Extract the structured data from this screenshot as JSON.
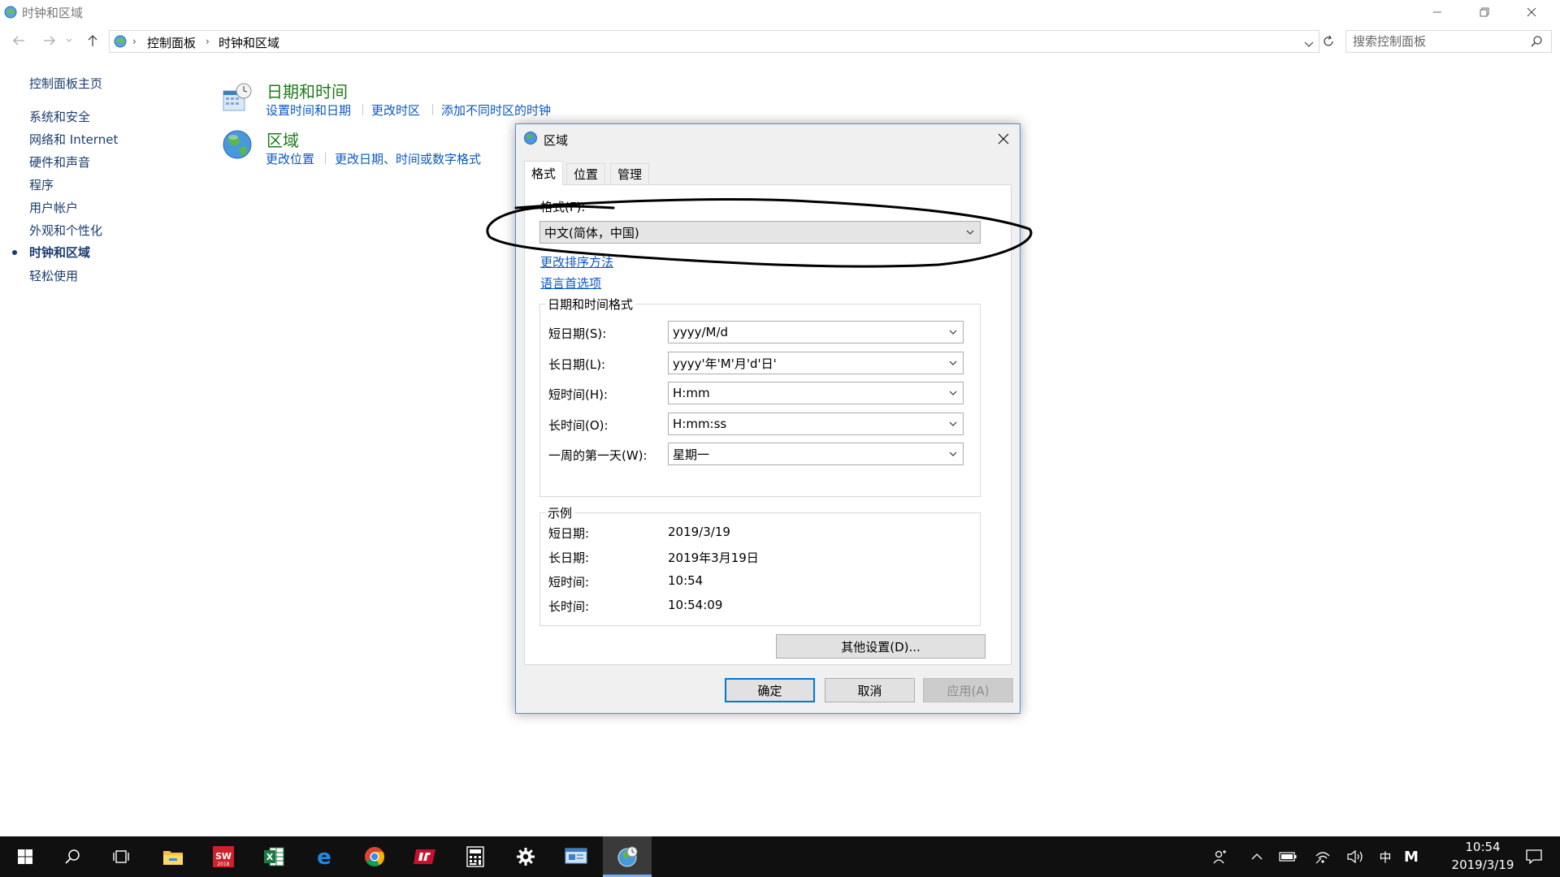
{
  "window": {
    "title": "时钟和区域"
  },
  "address": {
    "breadcrumb": [
      "控制面板",
      "时钟和区域"
    ],
    "search_placeholder": "搜索控制面板"
  },
  "sidebar": {
    "home": "控制面板主页",
    "items": [
      {
        "label": "系统和安全",
        "active": false
      },
      {
        "label": "网络和 Internet",
        "active": false
      },
      {
        "label": "硬件和声音",
        "active": false
      },
      {
        "label": "程序",
        "active": false
      },
      {
        "label": "用户帐户",
        "active": false
      },
      {
        "label": "外观和个性化",
        "active": false
      },
      {
        "label": "时钟和区域",
        "active": true
      },
      {
        "label": "轻松使用",
        "active": false
      }
    ]
  },
  "categories": {
    "datetime": {
      "title": "日期和时间",
      "links": [
        "设置时间和日期",
        "更改时区",
        "添加不同时区的时钟"
      ]
    },
    "region": {
      "title": "区域",
      "links": [
        "更改位置",
        "更改日期、时间或数字格式"
      ]
    }
  },
  "dialog": {
    "title": "区域",
    "tabs": [
      "格式",
      "位置",
      "管理"
    ],
    "active_tab": "格式",
    "format_label": "格式(F):",
    "format_value": "中文(简体，中国)",
    "links": [
      "更改排序方法",
      "语言首选项"
    ],
    "datetime_group": {
      "title": "日期和时间格式",
      "rows": [
        {
          "label": "短日期(S):",
          "value": "yyyy/M/d"
        },
        {
          "label": "长日期(L):",
          "value": "yyyy'年'M'月'd'日'"
        },
        {
          "label": "短时间(H):",
          "value": "H:mm"
        },
        {
          "label": "长时间(O):",
          "value": "H:mm:ss"
        },
        {
          "label": "一周的第一天(W):",
          "value": "星期一"
        }
      ]
    },
    "example_group": {
      "title": "示例",
      "rows": [
        {
          "label": "短日期:",
          "value": "2019/3/19"
        },
        {
          "label": "长日期:",
          "value": "2019年3月19日"
        },
        {
          "label": "短时间:",
          "value": "10:54"
        },
        {
          "label": "长时间:",
          "value": "10:54:09"
        }
      ]
    },
    "other_settings": "其他设置(D)...",
    "buttons": {
      "ok": "确定",
      "cancel": "取消",
      "apply": "应用(A)"
    }
  },
  "taskbar": {
    "ime": "中",
    "ime_mode": "M",
    "time": "10:54",
    "date": "2019/3/19"
  },
  "colors": {
    "link": "#0a57c2",
    "category_title": "#1e7a1e",
    "dialog_border": "#4a90d9",
    "taskbar": "#101010",
    "default_button_border": "#0078d7"
  }
}
